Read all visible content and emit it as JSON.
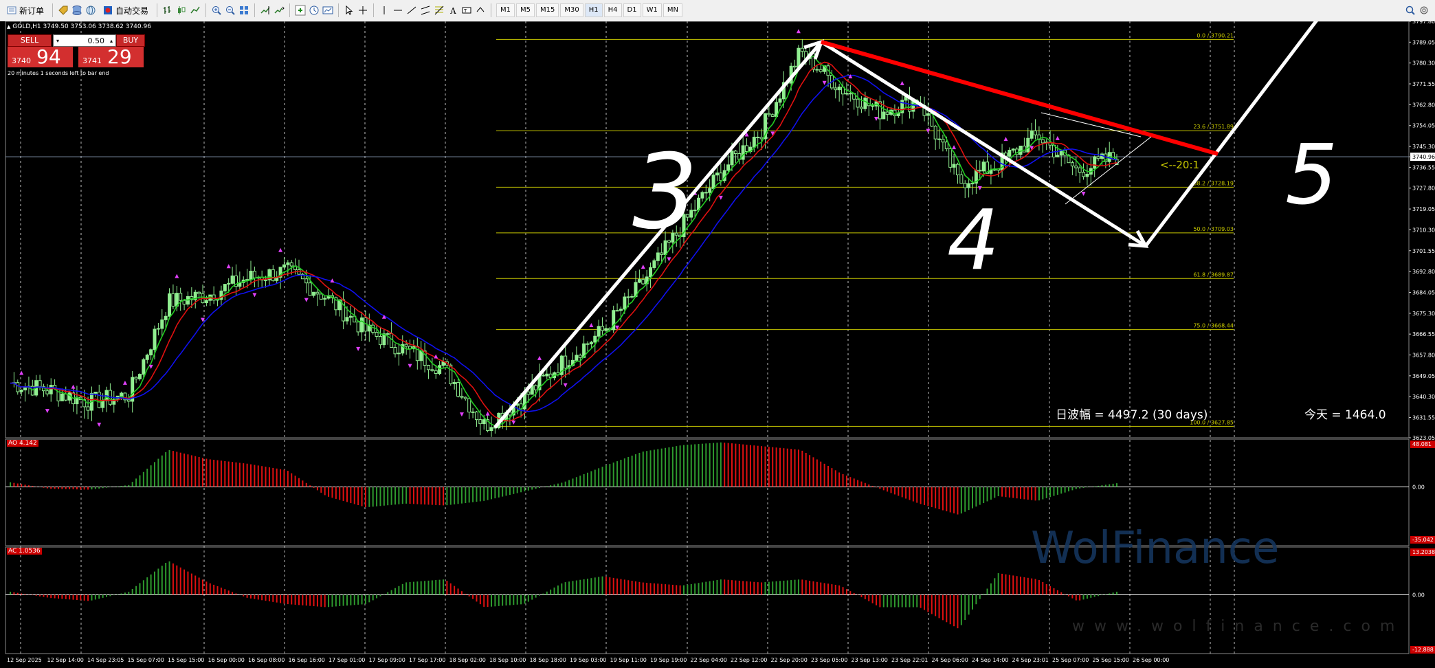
{
  "toolbar": {
    "new_order": "新订单",
    "auto_trade": "自动交易",
    "timeframes": [
      "M1",
      "M5",
      "M15",
      "M30",
      "H1",
      "H4",
      "D1",
      "W1",
      "MN"
    ]
  },
  "header": {
    "symbol_line": "GOLD,H1  3749.50 3753.06 3738.62 3740.96",
    "timer_text": "20 minutes 1 seconds left to bar end"
  },
  "trade_panel": {
    "sell_label": "SELL",
    "buy_label": "BUY",
    "lot": "0.50",
    "sell_small": "3740",
    "sell_big": "94",
    "buy_small": "3741",
    "buy_big": "29"
  },
  "fib_levels": [
    {
      "label": "0.0  /  3790.21",
      "value": 3790.21
    },
    {
      "label": "23.6  /  3751.89",
      "value": 3751.89
    },
    {
      "label": "38.2  /  3728.19",
      "value": 3728.19
    },
    {
      "label": "50.0  /  3709.03",
      "value": 3709.03
    },
    {
      "label": "61.8  /  3689.87",
      "value": 3689.87
    },
    {
      "label": "75.0  /  3668.44",
      "value": 3668.44
    },
    {
      "label": "100.0  /  3627.85",
      "value": 3627.85
    }
  ],
  "price_axis": [
    "3797.80",
    "3789.05",
    "3780.30",
    "3771.55",
    "3762.80",
    "3754.05",
    "3745.30",
    "3740.96",
    "3736.55",
    "3727.80",
    "3719.05",
    "3710.30",
    "3701.55",
    "3692.80",
    "3684.05",
    "3675.30",
    "3666.55",
    "3657.80",
    "3649.05",
    "3640.30",
    "3631.55",
    "3623.05"
  ],
  "current_price": "3740.96",
  "annotations": {
    "wave3": "3",
    "wave4": "4",
    "wave5": "5",
    "ratio": "<--20:1",
    "range_text": "日波幅 = 4497.2  (30 days)",
    "today_text": "今天 = 1464.0"
  },
  "ao": {
    "label": "AO 4.142",
    "axis": [
      "48.081",
      "0.00",
      "-35.042"
    ]
  },
  "ac": {
    "label": "AC 1.0536",
    "axis": [
      "13.2038",
      "0.00",
      "-12.888"
    ]
  },
  "time_axis": [
    "12 Sep 2025",
    "12 Sep 14:00",
    "14 Sep 23:05",
    "15 Sep 07:00",
    "15 Sep 15:00",
    "16 Sep 00:00",
    "16 Sep 08:00",
    "16 Sep 16:00",
    "17 Sep 01:00",
    "17 Sep 09:00",
    "17 Sep 17:00",
    "18 Sep 02:00",
    "18 Sep 10:00",
    "18 Sep 18:00",
    "19 Sep 03:00",
    "19 Sep 11:00",
    "19 Sep 19:00",
    "22 Sep 04:00",
    "22 Sep 12:00",
    "22 Sep 20:00",
    "23 Sep 05:00",
    "23 Sep 13:00",
    "23 Sep 22:01",
    "24 Sep 06:00",
    "24 Sep 14:00",
    "24 Sep 23:01",
    "25 Sep 07:00",
    "25 Sep 15:00",
    "26 Sep 00:00"
  ],
  "watermark": {
    "brand": "WolFinance",
    "url": "www.wolfinance.com"
  },
  "colors": {
    "bull_candle": "#90ee90",
    "ma_fast": "#22cc22",
    "ma_mid": "#e01010",
    "ma_slow": "#1010ee",
    "fib": "#c8c800",
    "ao_up": "#2e9a2e",
    "ao_down": "#e01010"
  },
  "chart_data": {
    "type": "candlestick",
    "symbol": "GOLD",
    "timeframe": "H1",
    "ohlc_current": {
      "open": 3749.5,
      "high": 3753.06,
      "low": 3738.62,
      "close": 3740.96
    },
    "ylim": [
      3623.05,
      3797.8
    ],
    "x_range": [
      "12 Sep 2025",
      "26 Sep 00:00"
    ],
    "close_path": [
      {
        "t": "12 Sep 2025",
        "close": 3646
      },
      {
        "t": "12 Sep 14:00",
        "close": 3643
      },
      {
        "t": "14 Sep 23:05",
        "close": 3638
      },
      {
        "t": "15 Sep 07:00",
        "close": 3641
      },
      {
        "t": "15 Sep 15:00",
        "close": 3680
      },
      {
        "t": "16 Sep 00:00",
        "close": 3683
      },
      {
        "t": "16 Sep 08:00",
        "close": 3690
      },
      {
        "t": "16 Sep 16:00",
        "close": 3693
      },
      {
        "t": "17 Sep 01:00",
        "close": 3682
      },
      {
        "t": "17 Sep 09:00",
        "close": 3668
      },
      {
        "t": "17 Sep 17:00",
        "close": 3660
      },
      {
        "t": "18 Sep 02:00",
        "close": 3652
      },
      {
        "t": "18 Sep 10:00",
        "close": 3628
      },
      {
        "t": "18 Sep 18:00",
        "close": 3640
      },
      {
        "t": "19 Sep 03:00",
        "close": 3655
      },
      {
        "t": "19 Sep 11:00",
        "close": 3668
      },
      {
        "t": "19 Sep 19:00",
        "close": 3688
      },
      {
        "t": "22 Sep 04:00",
        "close": 3712
      },
      {
        "t": "22 Sep 12:00",
        "close": 3735
      },
      {
        "t": "22 Sep 20:00",
        "close": 3752
      },
      {
        "t": "23 Sep 05:00",
        "close": 3785
      },
      {
        "t": "23 Sep 13:00",
        "close": 3770
      },
      {
        "t": "23 Sep 22:01",
        "close": 3760
      },
      {
        "t": "24 Sep 06:00",
        "close": 3765
      },
      {
        "t": "24 Sep 14:00",
        "close": 3730
      },
      {
        "t": "24 Sep 23:01",
        "close": 3738
      },
      {
        "t": "25 Sep 07:00",
        "close": 3750
      },
      {
        "t": "25 Sep 15:00",
        "close": 3735
      },
      {
        "t": "26 Sep 00:00",
        "close": 3741
      }
    ],
    "ao_values": [
      5,
      -2,
      -3,
      2,
      40,
      30,
      25,
      18,
      -10,
      -22,
      -18,
      -20,
      -15,
      -5,
      5,
      22,
      38,
      45,
      48,
      44,
      40,
      15,
      -2,
      -18,
      -30,
      -10,
      -15,
      -2,
      4
    ],
    "ac_values": [
      1,
      -1,
      -2,
      1,
      11,
      4,
      -1,
      -3,
      -4,
      -3,
      4,
      5,
      -4,
      -3,
      4,
      6,
      4,
      3,
      5,
      4,
      5,
      3,
      -4,
      -4,
      -11,
      7,
      5,
      -2,
      1
    ]
  }
}
